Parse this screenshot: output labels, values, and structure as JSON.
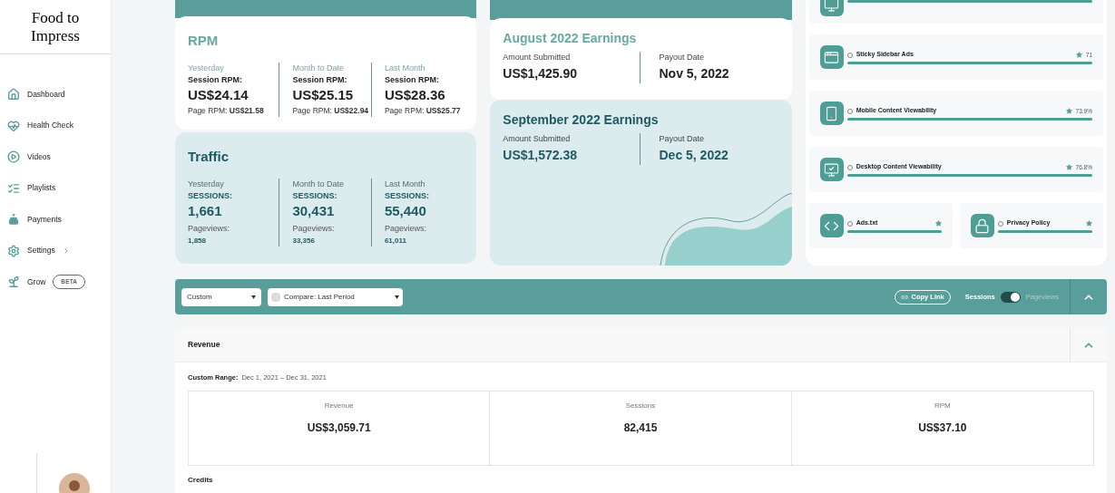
{
  "brand": {
    "name": "Food to Impress"
  },
  "nav": [
    {
      "label": "Dashboard",
      "selected": false,
      "kind": "plain"
    },
    {
      "label": "Health Check",
      "selected": false,
      "kind": "plain"
    },
    {
      "label": "Videos",
      "selected": false,
      "kind": "plain"
    },
    {
      "label": "Playlists",
      "selected": false,
      "kind": "plain"
    },
    {
      "label": "Payments",
      "selected": false,
      "kind": "plain"
    },
    {
      "label": "Settings",
      "selected": false,
      "kind": "submenu"
    },
    {
      "label": "Grow",
      "selected": false,
      "kind": "badge",
      "badge": "BETA"
    }
  ],
  "rpm": {
    "title": "RPM",
    "columns": [
      {
        "period": "Yesterday",
        "metric": "Session RPM:",
        "value": "US$24.14",
        "sub_label": "Page RPM:",
        "sub_value": "US$21.58"
      },
      {
        "period": "Month to Date",
        "metric": "Session RPM:",
        "value": "US$25.15",
        "sub_label": "Page RPM:",
        "sub_value": "US$22.94"
      },
      {
        "period": "Last Month",
        "metric": "Session RPM:",
        "value": "US$28.36",
        "sub_label": "Page RPM:",
        "sub_value": "US$25.77"
      }
    ]
  },
  "traffic": {
    "title": "Traffic",
    "columns": [
      {
        "period": "Yesterday",
        "metric": "SESSIONS:",
        "value": "1,661",
        "sub_label": "Pageviews:",
        "sub_value": "1,858"
      },
      {
        "period": "Month to Date",
        "metric": "SESSIONS:",
        "value": "30,431",
        "sub_label": "Pageviews:",
        "sub_value": "33,356"
      },
      {
        "period": "Last Month",
        "metric": "SESSIONS:",
        "value": "55,440",
        "sub_label": "Pageviews:",
        "sub_value": "61,011"
      }
    ]
  },
  "earnings": [
    {
      "title": "August 2022 Earnings",
      "amount_label": "Amount Submitted",
      "amount": "US$1,425.90",
      "date_label": "Payout Date",
      "date": "Nov 5, 2022",
      "selected": false
    },
    {
      "title": "September 2022 Earnings",
      "amount_label": "Amount Submitted",
      "amount": "US$1,572.38",
      "date_label": "Payout Date",
      "date": "Dec 5, 2022",
      "selected": true
    }
  ],
  "health": [
    {
      "kind": "wide",
      "level": 1
    },
    {
      "kind": "wide",
      "label": "Sticky Sidebar Ads",
      "score": "71",
      "level": 1
    },
    {
      "kind": "wide",
      "label": "Mobile Content Viewability",
      "score": "73.9%",
      "level": 1
    },
    {
      "kind": "wide",
      "label": "Desktop Content Viewability",
      "score": "76.8%",
      "level": 1
    },
    {
      "kind": "half",
      "label": "Ads.txt",
      "level": 1
    },
    {
      "kind": "half",
      "label": "Privacy Policy",
      "level": 1
    }
  ],
  "filter_bar": {
    "range": "Custom",
    "compare": {
      "label": "Compare: Last Period",
      "checked": false
    },
    "copy_link": "Copy Link",
    "toggle": {
      "left_label": "Sessions",
      "right_label": "Pageviews",
      "on": true
    }
  },
  "revenue": {
    "title": "Revenue",
    "range_label": "Custom Range:",
    "range": "Dec 1, 2021 – Dec 31, 2021",
    "stats": [
      {
        "label": "Revenue",
        "value": "US$3,059.71"
      },
      {
        "label": "Sessions",
        "value": "82,415"
      },
      {
        "label": "RPM",
        "value": "US$37.10"
      }
    ],
    "next_section": "Credits"
  }
}
